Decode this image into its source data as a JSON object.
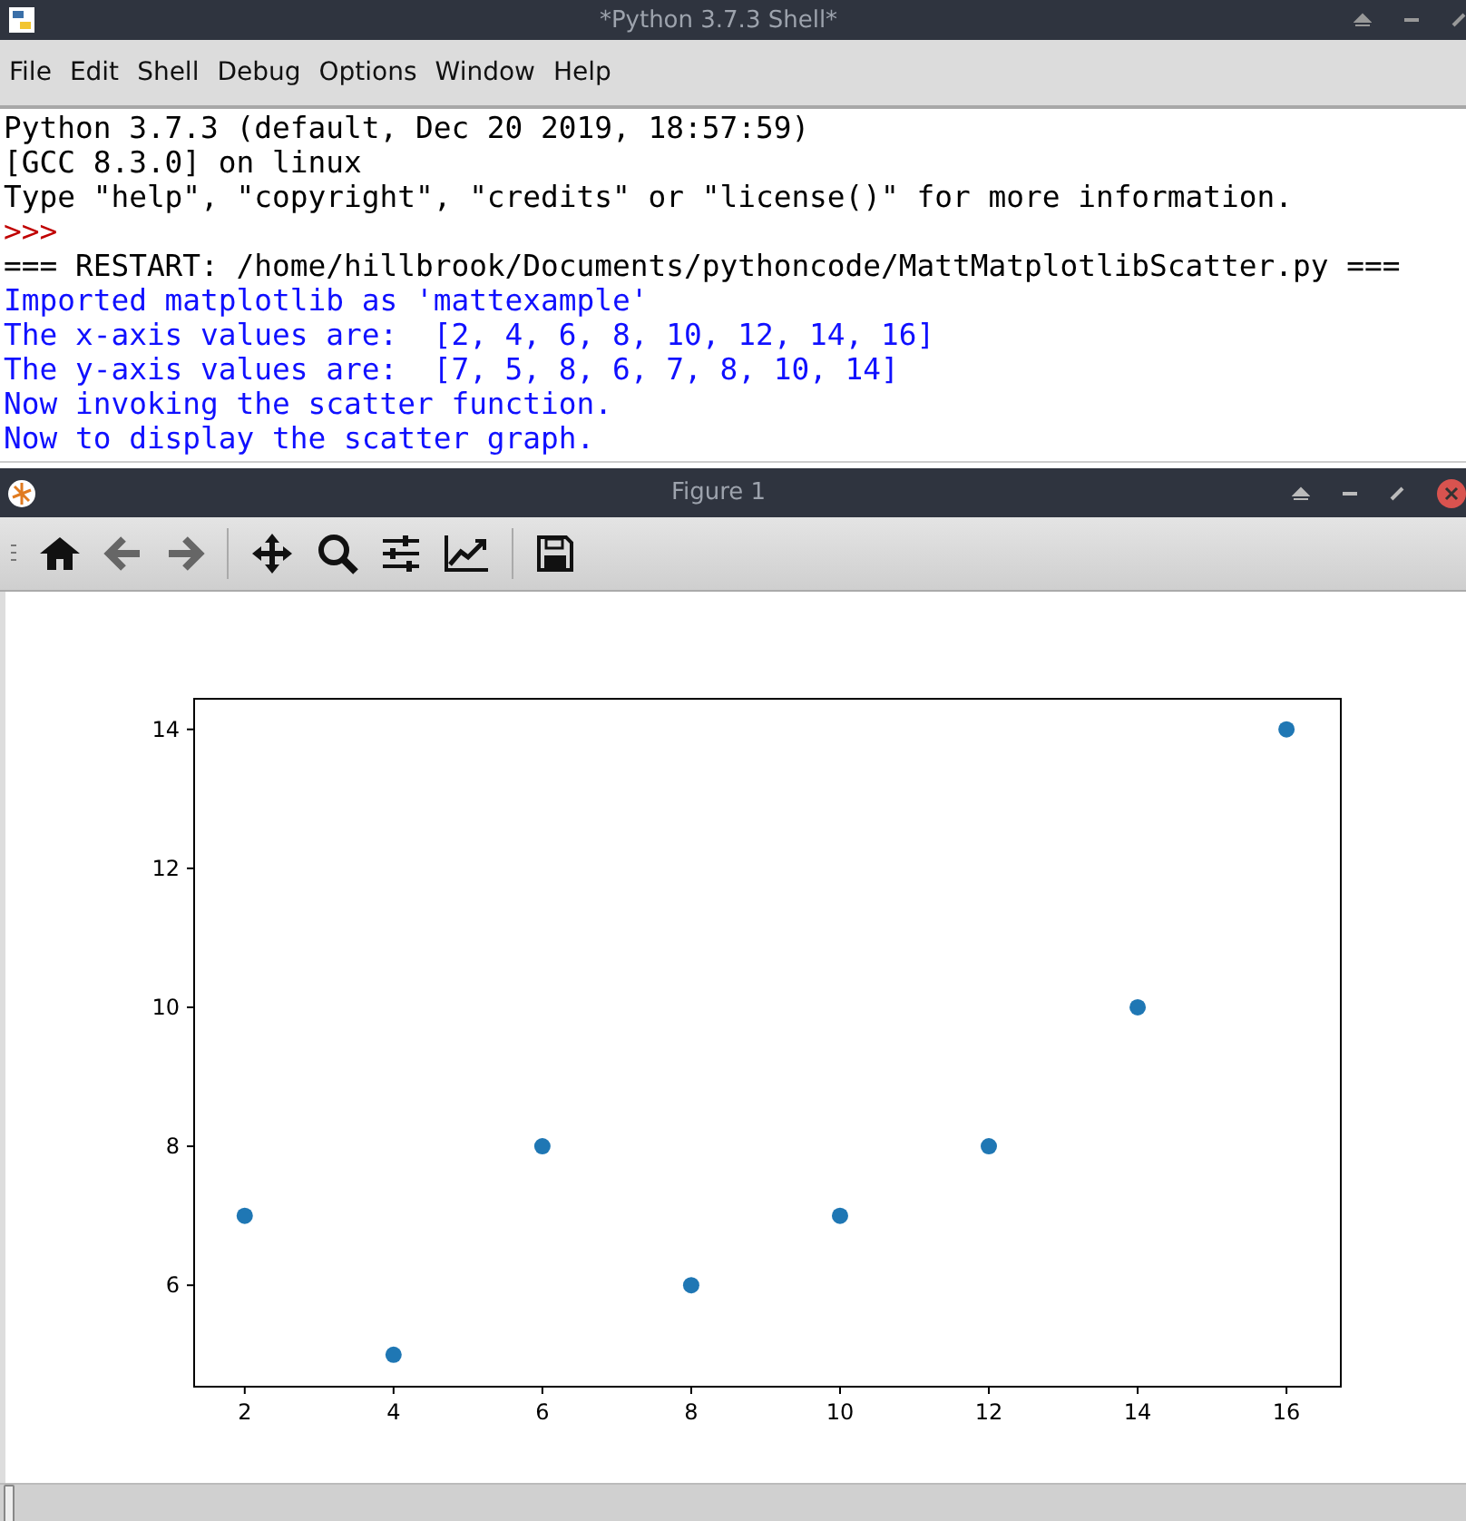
{
  "shell_window": {
    "title": "*Python 3.7.3 Shell*"
  },
  "menu": [
    {
      "label": "File"
    },
    {
      "label": "Edit"
    },
    {
      "label": "Shell"
    },
    {
      "label": "Debug"
    },
    {
      "label": "Options"
    },
    {
      "label": "Window"
    },
    {
      "label": "Help"
    }
  ],
  "shell_lines": [
    {
      "kind": "normal",
      "text": "Python 3.7.3 (default, Dec 20 2019, 18:57:59)"
    },
    {
      "kind": "normal",
      "text": "[GCC 8.3.0] on linux"
    },
    {
      "kind": "normal",
      "text": "Type \"help\", \"copyright\", \"credits\" or \"license()\" for more information."
    },
    {
      "kind": "prompt",
      "text": ">>>"
    },
    {
      "kind": "normal",
      "text": "=== RESTART: /home/hillbrook/Documents/pythoncode/MattMatplotlibScatter.py ==="
    },
    {
      "kind": "output",
      "text": "Imported matplotlib as 'mattexample'"
    },
    {
      "kind": "output",
      "text": "The x-axis values are:  [2, 4, 6, 8, 10, 12, 14, 16]"
    },
    {
      "kind": "output",
      "text": "The y-axis values are:  [7, 5, 8, 6, 7, 8, 10, 14]"
    },
    {
      "kind": "output",
      "text": "Now invoking the scatter function."
    },
    {
      "kind": "output",
      "text": "Now to display the scatter graph."
    }
  ],
  "figure_window": {
    "title": "Figure 1",
    "chart_data": {
      "type": "scatter",
      "x": [
        2,
        4,
        6,
        8,
        10,
        12,
        14,
        16
      ],
      "series": [
        {
          "color": "#1f77b4",
          "values": [
            7,
            5,
            8,
            6,
            7,
            8,
            10,
            14
          ]
        }
      ],
      "xlim": [
        1.32,
        16.73
      ],
      "ylim": [
        4.54,
        14.44
      ],
      "xticks": [
        2,
        4,
        6,
        8,
        10,
        12,
        14,
        16
      ],
      "yticks": [
        6,
        8,
        10,
        12,
        14
      ]
    }
  }
}
